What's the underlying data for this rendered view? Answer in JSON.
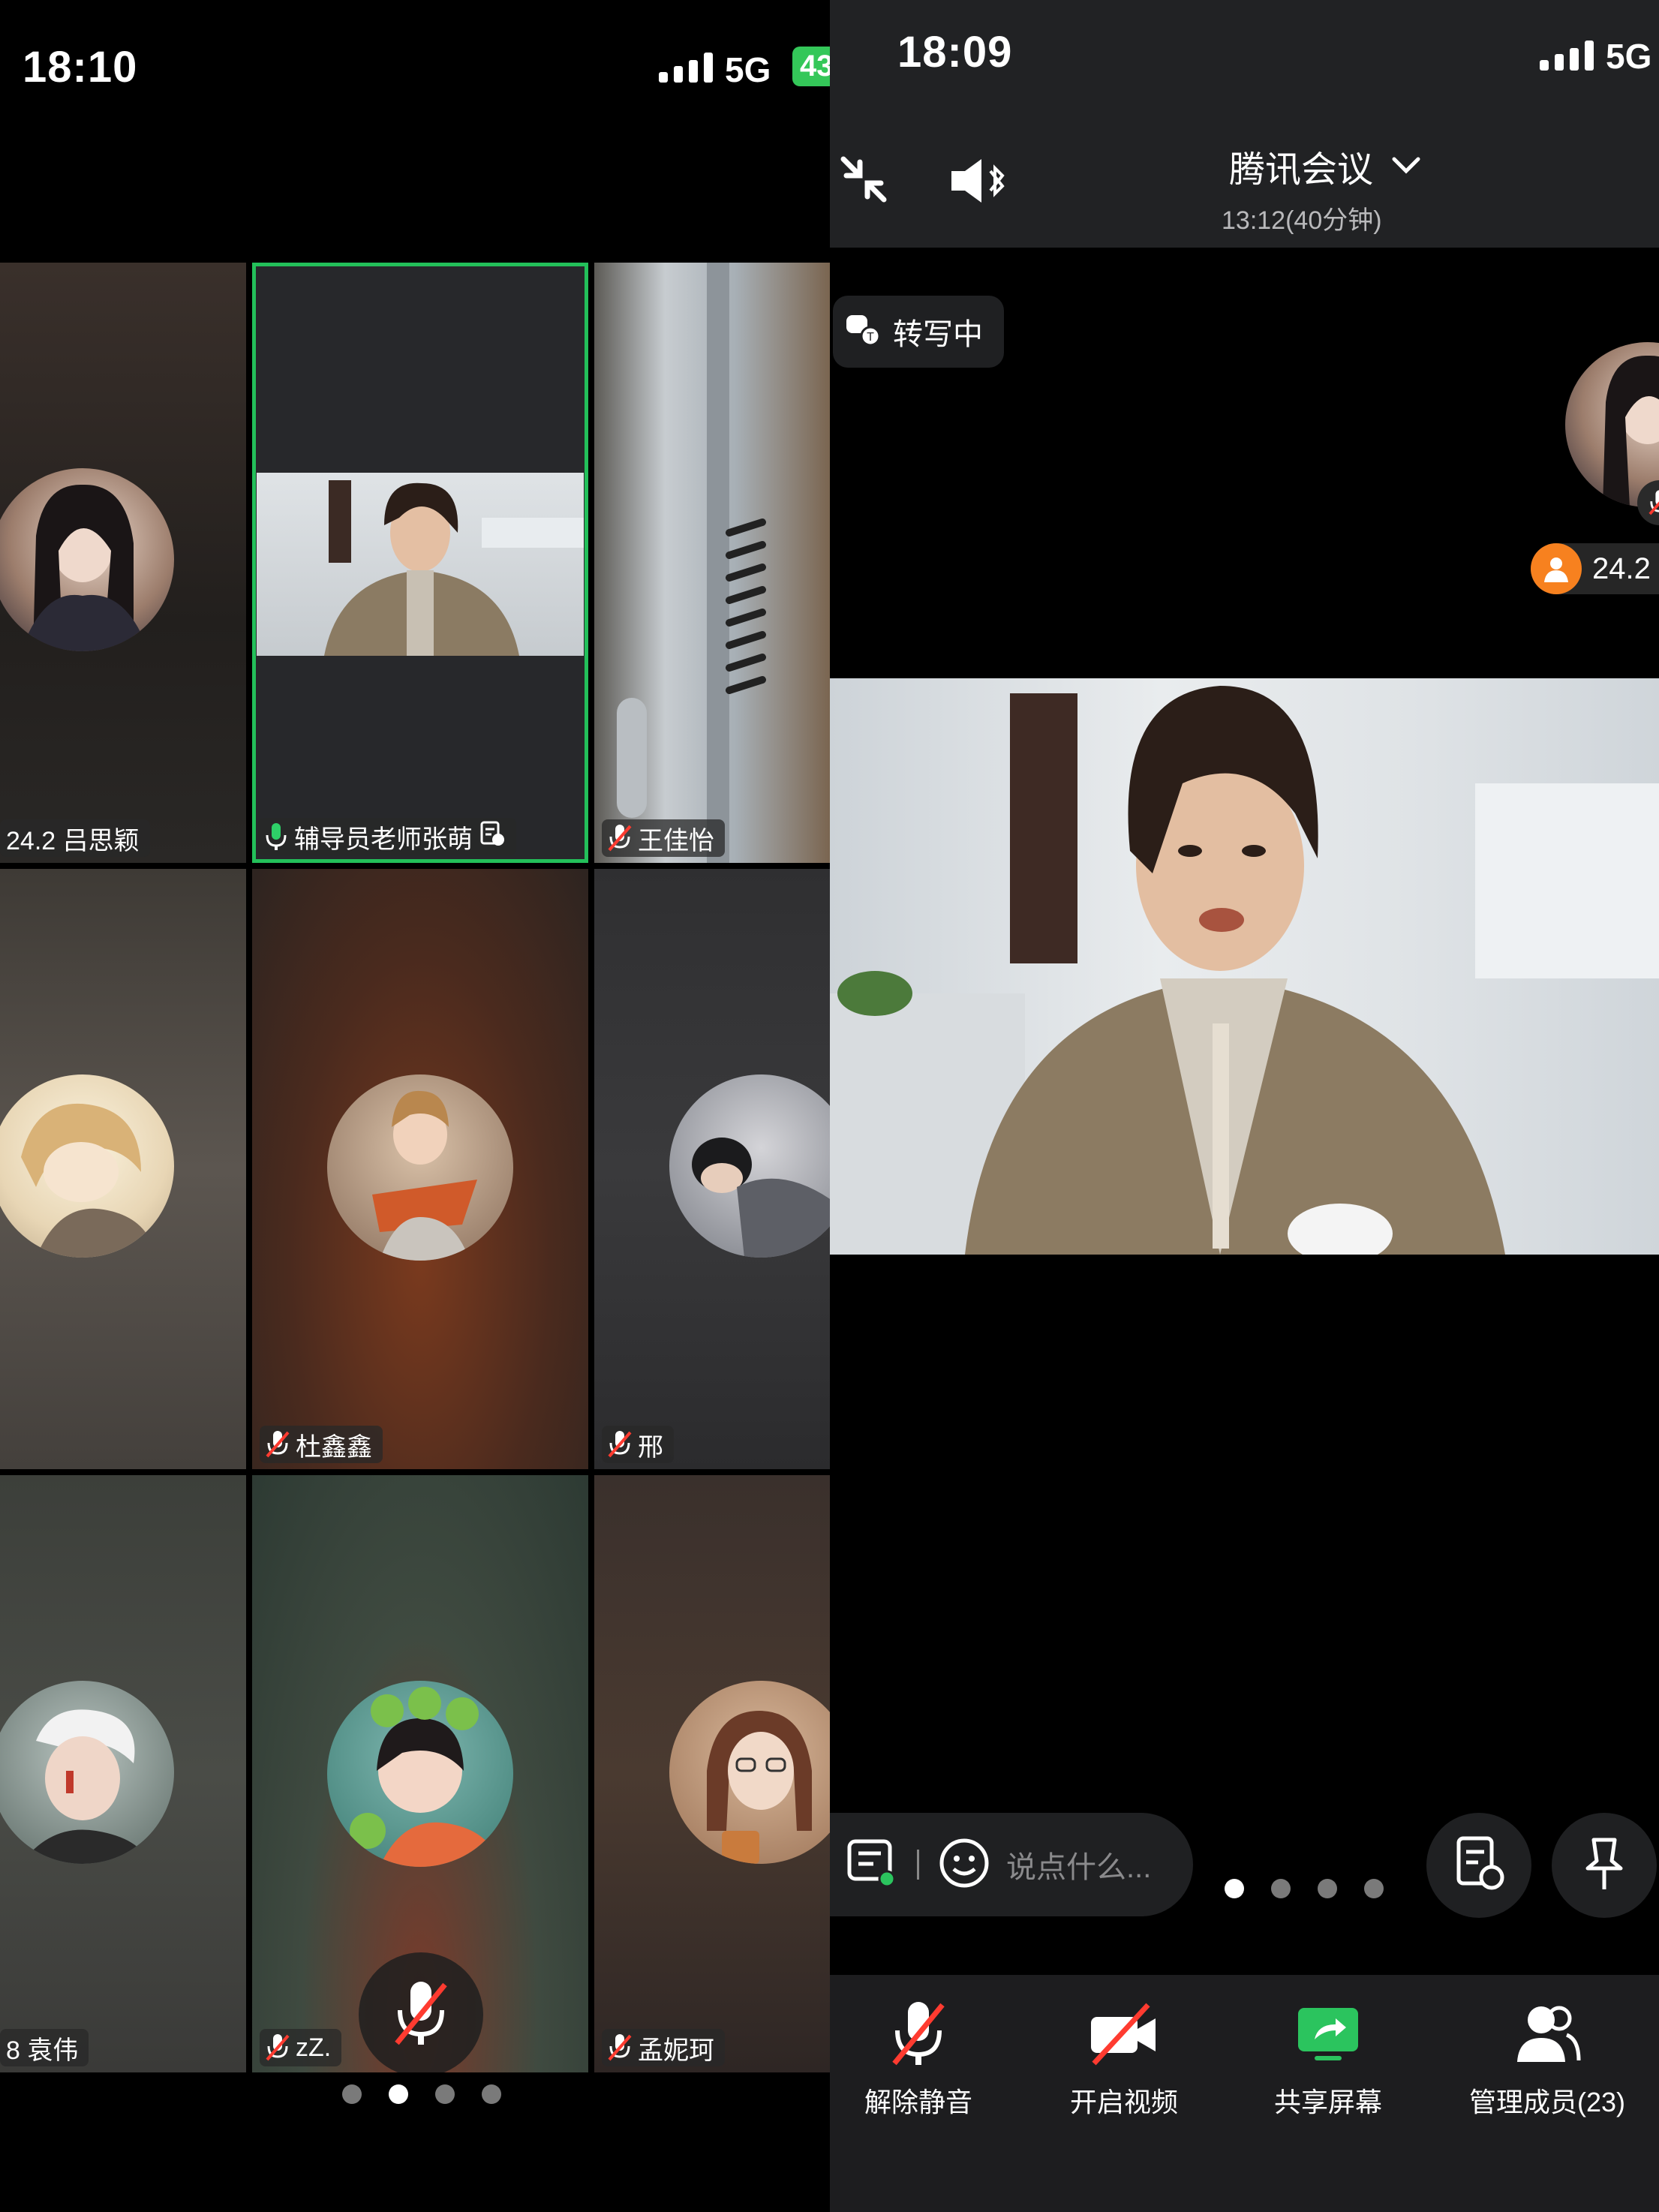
{
  "left": {
    "status": {
      "time": "18:10",
      "network": "5G",
      "battery": "43"
    },
    "tiles": [
      {
        "name": "24.2 吕思颖",
        "mic": "none"
      },
      {
        "name": "辅导员老师张萌",
        "mic": "on",
        "speaking": true
      },
      {
        "name": "王佳怡",
        "mic": "muted"
      },
      {
        "name": "",
        "mic": "none"
      },
      {
        "name": "杜鑫鑫",
        "mic": "muted"
      },
      {
        "name": "邢",
        "mic": "muted"
      },
      {
        "name": "8 袁伟",
        "mic": "none"
      },
      {
        "name": "zZ.",
        "mic": "muted"
      },
      {
        "name": "孟妮珂",
        "mic": "muted"
      }
    ],
    "pager_active": 1,
    "pager_count": 4
  },
  "right": {
    "status": {
      "time": "18:09",
      "network": "5G"
    },
    "header": {
      "title": "腾讯会议",
      "subtitle": "13:12(40分钟)"
    },
    "transcribing": "转写中",
    "participant_badge": "24.2",
    "chat_placeholder": "说点什么...",
    "pager_active": 0,
    "pager_count": 4,
    "toolbar": {
      "unmute": "解除静音",
      "video": "开启视频",
      "share": "共享屏幕",
      "members": "管理成员(23)"
    },
    "colors": {
      "accent": "#2bc45e",
      "badge": "#f7811f"
    }
  }
}
